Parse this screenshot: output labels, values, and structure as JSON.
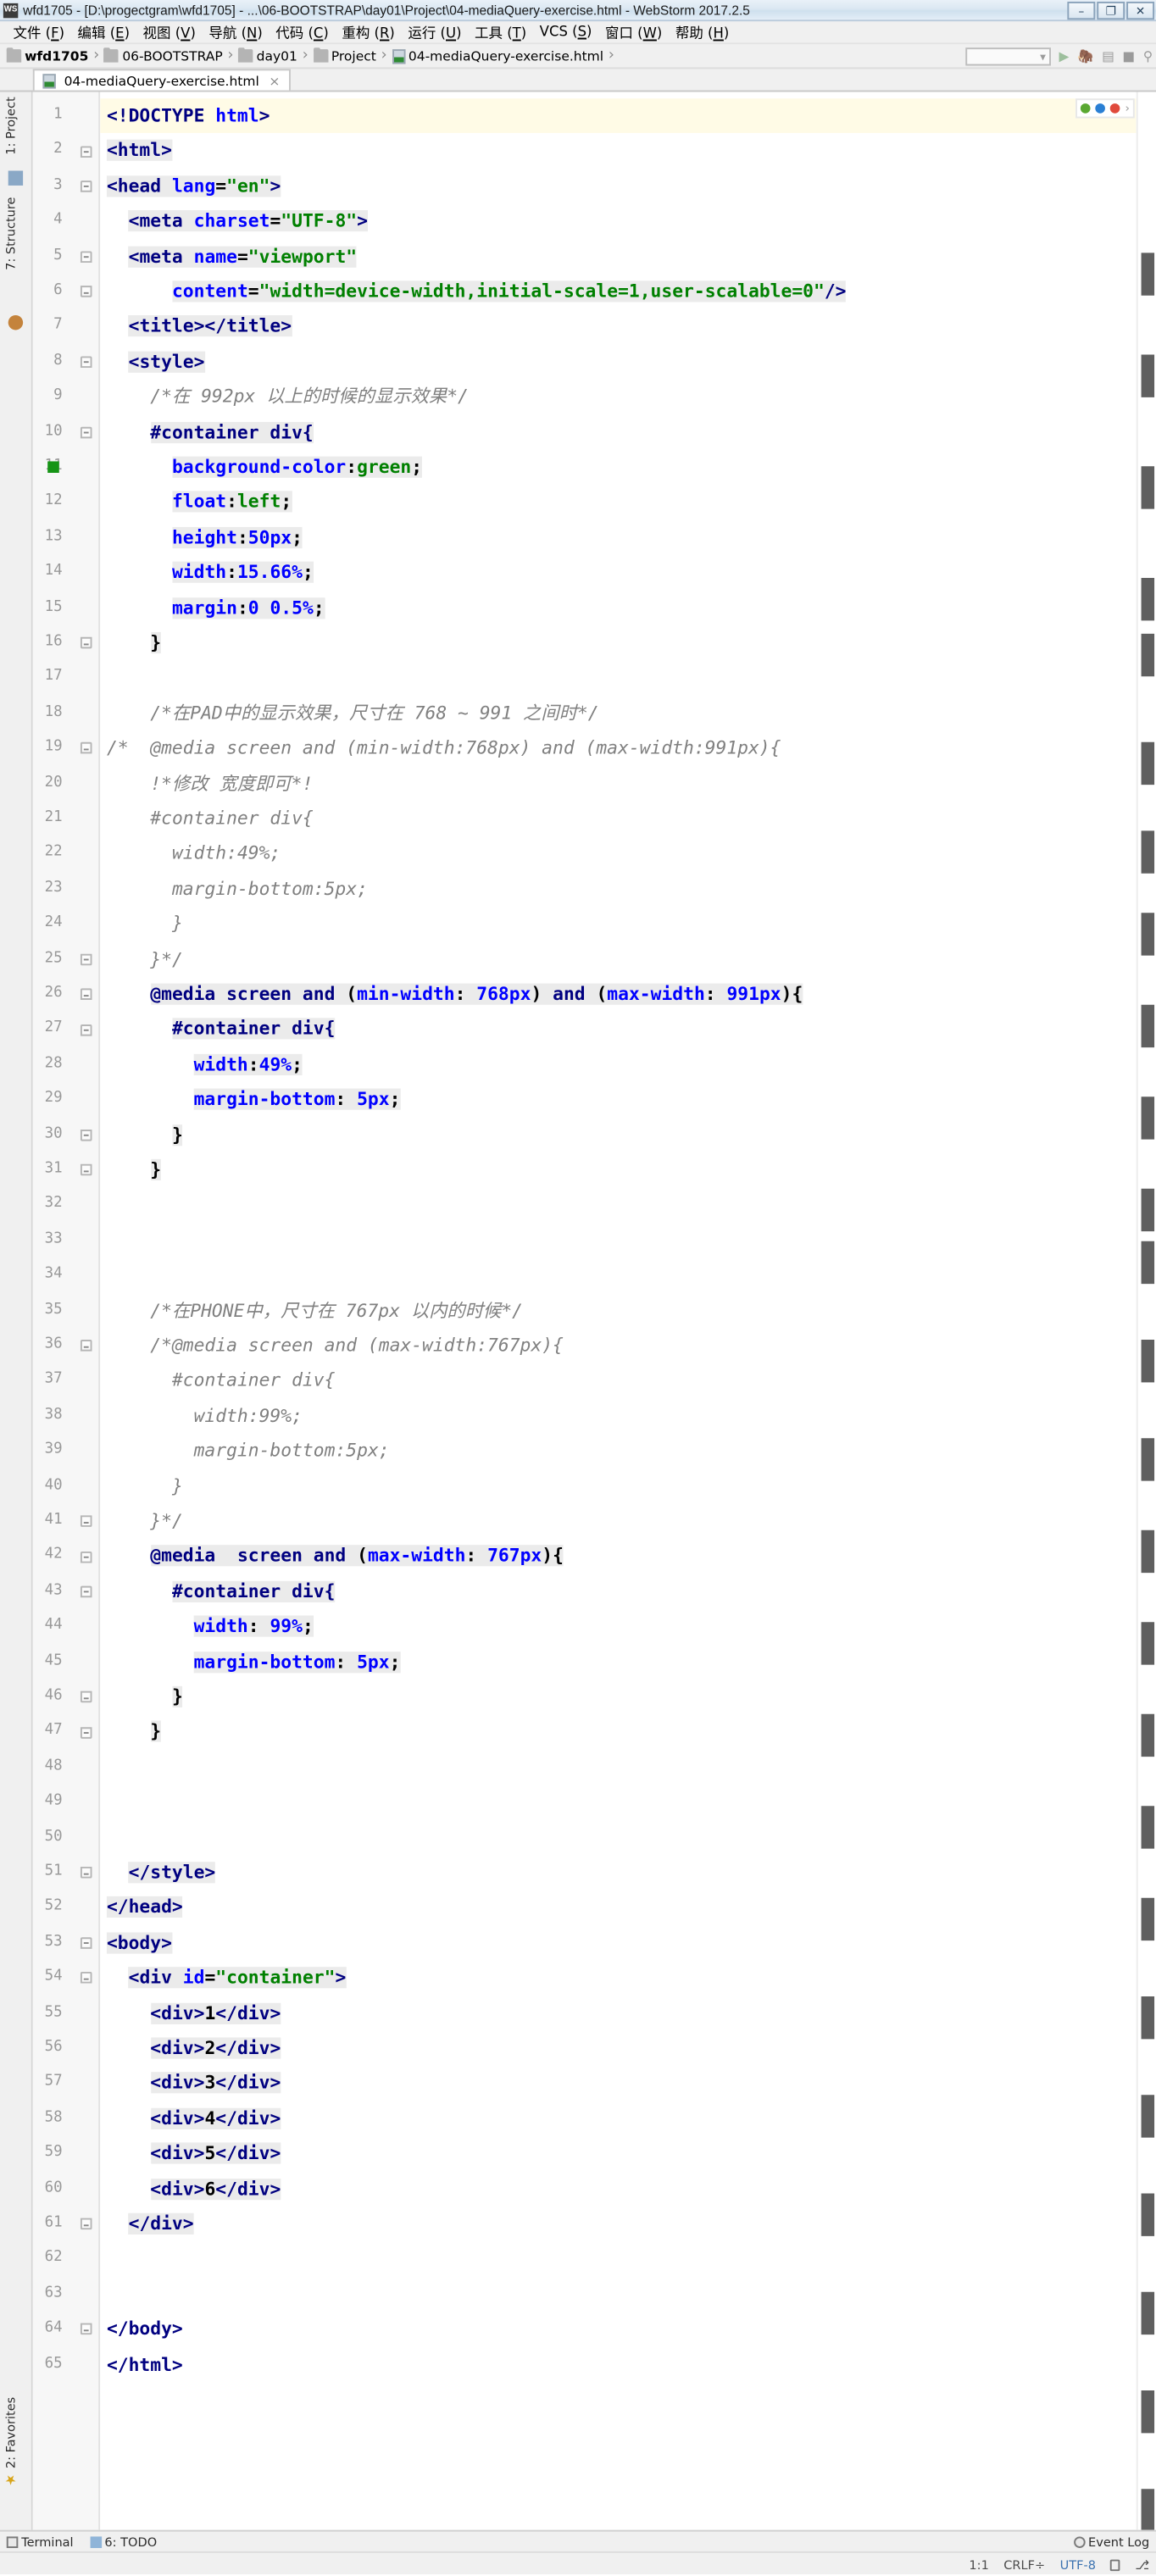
{
  "window": {
    "app_icon_text": "WS",
    "title": "wfd1705 - [D:\\progectgram\\wfd1705] - ...\\06-BOOTSTRAP\\day01\\Project\\04-mediaQuery-exercise.html - WebStorm 2017.2.5",
    "minimize": "–",
    "restore": "❐",
    "close": "✕"
  },
  "menubar": [
    {
      "label": "文件",
      "mnemonic": "F"
    },
    {
      "label": "编辑",
      "mnemonic": "E"
    },
    {
      "label": "视图",
      "mnemonic": "V"
    },
    {
      "label": "导航",
      "mnemonic": "N"
    },
    {
      "label": "代码",
      "mnemonic": "C"
    },
    {
      "label": "重构",
      "mnemonic": "R"
    },
    {
      "label": "运行",
      "mnemonic": "U"
    },
    {
      "label": "工具",
      "mnemonic": "T"
    },
    {
      "label": "VCS",
      "mnemonic": "S"
    },
    {
      "label": "窗口",
      "mnemonic": "W"
    },
    {
      "label": "帮助",
      "mnemonic": "H"
    }
  ],
  "breadcrumb": [
    {
      "label": "wfd1705",
      "icon": "folder-icon",
      "bold": true
    },
    {
      "label": "06-BOOTSTRAP",
      "icon": "folder-icon",
      "bold": false
    },
    {
      "label": "day01",
      "icon": "folder-icon",
      "bold": false
    },
    {
      "label": "Project",
      "icon": "folder-icon",
      "bold": false
    },
    {
      "label": "04-mediaQuery-exercise.html",
      "icon": "html-file-icon",
      "bold": false
    }
  ],
  "toolbar": {
    "run_config_placeholder": "",
    "icons": [
      "chevron-down-icon",
      "run-icon",
      "debug-icon",
      "coverage-icon",
      "stop-icon",
      "search-icon"
    ]
  },
  "tabs": [
    {
      "label": "04-mediaQuery-exercise.html",
      "icon": "html-file-icon",
      "close": "×",
      "active": true
    }
  ],
  "left_tool_window": [
    {
      "label": "1: Project",
      "mnemonic": "1"
    },
    {
      "label": "7: Structure",
      "mnemonic": "7"
    }
  ],
  "favorites": {
    "label": "2: Favorites",
    "star": "★"
  },
  "editor": {
    "first_line": 1,
    "total_lines": 65,
    "lines": [
      {
        "n": 1,
        "indent": 0,
        "tokens": [
          {
            "t": "tag",
            "v": "<!DOCTYPE "
          },
          {
            "t": "attr",
            "v": "html"
          },
          {
            "t": "tag",
            "v": ">"
          }
        ]
      },
      {
        "n": 2,
        "indent": 0,
        "tokens": [
          {
            "t": "tag",
            "v": "<html>"
          }
        ]
      },
      {
        "n": 3,
        "indent": 0,
        "tokens": [
          {
            "t": "tag",
            "v": "<head "
          },
          {
            "t": "attr",
            "v": "lang"
          },
          {
            "t": "plain",
            "v": "="
          },
          {
            "t": "val",
            "v": "\"en\""
          },
          {
            "t": "tag",
            "v": ">"
          }
        ]
      },
      {
        "n": 4,
        "indent": 1,
        "tokens": [
          {
            "t": "tag",
            "v": "<meta "
          },
          {
            "t": "attr",
            "v": "charset"
          },
          {
            "t": "plain",
            "v": "="
          },
          {
            "t": "val",
            "v": "\"UTF-8\""
          },
          {
            "t": "tag",
            "v": ">"
          }
        ]
      },
      {
        "n": 5,
        "indent": 1,
        "tokens": [
          {
            "t": "tag",
            "v": "<meta "
          },
          {
            "t": "attr",
            "v": "name"
          },
          {
            "t": "plain",
            "v": "="
          },
          {
            "t": "val",
            "v": "\"viewport\""
          }
        ]
      },
      {
        "n": 6,
        "indent": 3,
        "tokens": [
          {
            "t": "attr",
            "v": "content"
          },
          {
            "t": "plain",
            "v": "="
          },
          {
            "t": "val",
            "v": "\"width=device-width,initial-scale=1,user-scalable=0\""
          },
          {
            "t": "tag",
            "v": "/>"
          }
        ]
      },
      {
        "n": 7,
        "indent": 1,
        "tokens": [
          {
            "t": "tag",
            "v": "<title></title>"
          }
        ]
      },
      {
        "n": 8,
        "indent": 1,
        "tokens": [
          {
            "t": "tag",
            "v": "<style>"
          }
        ]
      },
      {
        "n": 9,
        "indent": 2,
        "tokens": [
          {
            "t": "cmt",
            "v": "/*在 992px 以上的时候的显示效果*/"
          }
        ]
      },
      {
        "n": 10,
        "indent": 2,
        "tokens": [
          {
            "t": "sel",
            "v": "#container div{"
          }
        ]
      },
      {
        "n": 11,
        "indent": 3,
        "tokens": [
          {
            "t": "prop",
            "v": "background-color"
          },
          {
            "t": "punc",
            "v": ":"
          },
          {
            "t": "pval",
            "v": "green"
          },
          {
            "t": "punc",
            "v": ";"
          }
        ]
      },
      {
        "n": 12,
        "indent": 3,
        "tokens": [
          {
            "t": "prop",
            "v": "float"
          },
          {
            "t": "punc",
            "v": ":"
          },
          {
            "t": "pval",
            "v": "left"
          },
          {
            "t": "punc",
            "v": ";"
          }
        ]
      },
      {
        "n": 13,
        "indent": 3,
        "tokens": [
          {
            "t": "prop",
            "v": "height"
          },
          {
            "t": "punc",
            "v": ":"
          },
          {
            "t": "num",
            "v": "50px"
          },
          {
            "t": "punc",
            "v": ";"
          }
        ]
      },
      {
        "n": 14,
        "indent": 3,
        "tokens": [
          {
            "t": "prop",
            "v": "width"
          },
          {
            "t": "punc",
            "v": ":"
          },
          {
            "t": "num",
            "v": "15.66%"
          },
          {
            "t": "punc",
            "v": ";"
          }
        ]
      },
      {
        "n": 15,
        "indent": 3,
        "tokens": [
          {
            "t": "prop",
            "v": "margin"
          },
          {
            "t": "punc",
            "v": ":"
          },
          {
            "t": "num",
            "v": "0 0.5%"
          },
          {
            "t": "punc",
            "v": ";"
          }
        ]
      },
      {
        "n": 16,
        "indent": 2,
        "tokens": [
          {
            "t": "punc",
            "v": "}"
          }
        ]
      },
      {
        "n": 17,
        "indent": 0,
        "tokens": []
      },
      {
        "n": 18,
        "indent": 2,
        "tokens": [
          {
            "t": "cmt",
            "v": "/*在PAD中的显示效果，尺寸在 768 ~ 991 之间时*/"
          }
        ]
      },
      {
        "n": 19,
        "indent": 0,
        "tokens": [
          {
            "t": "cmt",
            "v": "/*  @media screen and (min-width:768px) and (max-width:991px){"
          }
        ]
      },
      {
        "n": 20,
        "indent": 2,
        "tokens": [
          {
            "t": "cmt",
            "v": "!*修改 宽度即可*!"
          }
        ]
      },
      {
        "n": 21,
        "indent": 2,
        "tokens": [
          {
            "t": "cmt",
            "v": "#container div{"
          }
        ]
      },
      {
        "n": 22,
        "indent": 3,
        "tokens": [
          {
            "t": "cmt",
            "v": "width:49%;"
          }
        ]
      },
      {
        "n": 23,
        "indent": 3,
        "tokens": [
          {
            "t": "cmt",
            "v": "margin-bottom:5px;"
          }
        ]
      },
      {
        "n": 24,
        "indent": 3,
        "tokens": [
          {
            "t": "cmt",
            "v": "}"
          }
        ]
      },
      {
        "n": 25,
        "indent": 2,
        "tokens": [
          {
            "t": "cmt",
            "v": "}*/"
          }
        ]
      },
      {
        "n": 26,
        "indent": 2,
        "tokens": [
          {
            "t": "kw",
            "v": "@media "
          },
          {
            "t": "sel",
            "v": "screen "
          },
          {
            "t": "kw",
            "v": "and "
          },
          {
            "t": "punc",
            "v": "("
          },
          {
            "t": "prop",
            "v": "min-width"
          },
          {
            "t": "punc",
            "v": ": "
          },
          {
            "t": "num",
            "v": "768px"
          },
          {
            "t": "punc",
            "v": ") "
          },
          {
            "t": "kw",
            "v": "and "
          },
          {
            "t": "punc",
            "v": "("
          },
          {
            "t": "prop",
            "v": "max-width"
          },
          {
            "t": "punc",
            "v": ": "
          },
          {
            "t": "num",
            "v": "991px"
          },
          {
            "t": "punc",
            "v": "){"
          }
        ]
      },
      {
        "n": 27,
        "indent": 3,
        "tokens": [
          {
            "t": "sel",
            "v": "#container div{"
          }
        ]
      },
      {
        "n": 28,
        "indent": 4,
        "tokens": [
          {
            "t": "prop",
            "v": "width"
          },
          {
            "t": "punc",
            "v": ":"
          },
          {
            "t": "num",
            "v": "49%"
          },
          {
            "t": "punc",
            "v": ";"
          }
        ]
      },
      {
        "n": 29,
        "indent": 4,
        "tokens": [
          {
            "t": "prop",
            "v": "margin-bottom"
          },
          {
            "t": "punc",
            "v": ": "
          },
          {
            "t": "num",
            "v": "5px"
          },
          {
            "t": "punc",
            "v": ";"
          }
        ]
      },
      {
        "n": 30,
        "indent": 3,
        "tokens": [
          {
            "t": "punc",
            "v": "}"
          }
        ]
      },
      {
        "n": 31,
        "indent": 2,
        "tokens": [
          {
            "t": "punc",
            "v": "}"
          }
        ]
      },
      {
        "n": 32,
        "indent": 0,
        "tokens": []
      },
      {
        "n": 33,
        "indent": 0,
        "tokens": []
      },
      {
        "n": 34,
        "indent": 0,
        "tokens": []
      },
      {
        "n": 35,
        "indent": 2,
        "tokens": [
          {
            "t": "cmt",
            "v": "/*在PHONE中，尺寸在 767px 以内的时候*/"
          }
        ]
      },
      {
        "n": 36,
        "indent": 2,
        "tokens": [
          {
            "t": "cmt",
            "v": "/*@media screen and (max-width:767px){"
          }
        ]
      },
      {
        "n": 37,
        "indent": 3,
        "tokens": [
          {
            "t": "cmt",
            "v": "#container div{"
          }
        ]
      },
      {
        "n": 38,
        "indent": 4,
        "tokens": [
          {
            "t": "cmt",
            "v": "width:99%;"
          }
        ]
      },
      {
        "n": 39,
        "indent": 4,
        "tokens": [
          {
            "t": "cmt",
            "v": "margin-bottom:5px;"
          }
        ]
      },
      {
        "n": 40,
        "indent": 3,
        "tokens": [
          {
            "t": "cmt",
            "v": "}"
          }
        ]
      },
      {
        "n": 41,
        "indent": 2,
        "tokens": [
          {
            "t": "cmt",
            "v": "}*/"
          }
        ]
      },
      {
        "n": 42,
        "indent": 2,
        "tokens": [
          {
            "t": "kw",
            "v": "@media  "
          },
          {
            "t": "sel",
            "v": "screen "
          },
          {
            "t": "kw",
            "v": "and "
          },
          {
            "t": "punc",
            "v": "("
          },
          {
            "t": "prop",
            "v": "max-width"
          },
          {
            "t": "punc",
            "v": ": "
          },
          {
            "t": "num",
            "v": "767px"
          },
          {
            "t": "punc",
            "v": "){"
          }
        ]
      },
      {
        "n": 43,
        "indent": 3,
        "tokens": [
          {
            "t": "sel",
            "v": "#container div{"
          }
        ]
      },
      {
        "n": 44,
        "indent": 4,
        "tokens": [
          {
            "t": "prop",
            "v": "width"
          },
          {
            "t": "punc",
            "v": ": "
          },
          {
            "t": "num",
            "v": "99%"
          },
          {
            "t": "punc",
            "v": ";"
          }
        ]
      },
      {
        "n": 45,
        "indent": 4,
        "tokens": [
          {
            "t": "prop",
            "v": "margin-bottom"
          },
          {
            "t": "punc",
            "v": ": "
          },
          {
            "t": "num",
            "v": "5px"
          },
          {
            "t": "punc",
            "v": ";"
          }
        ]
      },
      {
        "n": 46,
        "indent": 3,
        "tokens": [
          {
            "t": "punc",
            "v": "}"
          }
        ]
      },
      {
        "n": 47,
        "indent": 2,
        "tokens": [
          {
            "t": "punc",
            "v": "}"
          }
        ]
      },
      {
        "n": 48,
        "indent": 0,
        "tokens": []
      },
      {
        "n": 49,
        "indent": 0,
        "tokens": []
      },
      {
        "n": 50,
        "indent": 0,
        "tokens": []
      },
      {
        "n": 51,
        "indent": 1,
        "tokens": [
          {
            "t": "tag",
            "v": "</style>"
          }
        ]
      },
      {
        "n": 52,
        "indent": 0,
        "tokens": [
          {
            "t": "tag",
            "v": "</head>"
          }
        ]
      },
      {
        "n": 53,
        "indent": 0,
        "tokens": [
          {
            "t": "tag",
            "v": "<body>"
          }
        ]
      },
      {
        "n": 54,
        "indent": 1,
        "tokens": [
          {
            "t": "tag",
            "v": "<div "
          },
          {
            "t": "attr",
            "v": "id"
          },
          {
            "t": "plain",
            "v": "="
          },
          {
            "t": "val",
            "v": "\"container\""
          },
          {
            "t": "tag",
            "v": ">"
          }
        ]
      },
      {
        "n": 55,
        "indent": 2,
        "tokens": [
          {
            "t": "tag",
            "v": "<div>"
          },
          {
            "t": "plain",
            "v": "1"
          },
          {
            "t": "tag",
            "v": "</div>"
          }
        ]
      },
      {
        "n": 56,
        "indent": 2,
        "tokens": [
          {
            "t": "tag",
            "v": "<div>"
          },
          {
            "t": "plain",
            "v": "2"
          },
          {
            "t": "tag",
            "v": "</div>"
          }
        ]
      },
      {
        "n": 57,
        "indent": 2,
        "tokens": [
          {
            "t": "tag",
            "v": "<div>"
          },
          {
            "t": "plain",
            "v": "3"
          },
          {
            "t": "tag",
            "v": "</div>"
          }
        ]
      },
      {
        "n": 58,
        "indent": 2,
        "tokens": [
          {
            "t": "tag",
            "v": "<div>"
          },
          {
            "t": "plain",
            "v": "4"
          },
          {
            "t": "tag",
            "v": "</div>"
          }
        ]
      },
      {
        "n": 59,
        "indent": 2,
        "tokens": [
          {
            "t": "tag",
            "v": "<div>"
          },
          {
            "t": "plain",
            "v": "5"
          },
          {
            "t": "tag",
            "v": "</div>"
          }
        ]
      },
      {
        "n": 60,
        "indent": 2,
        "tokens": [
          {
            "t": "tag",
            "v": "<div>"
          },
          {
            "t": "plain",
            "v": "6"
          },
          {
            "t": "tag",
            "v": "</div>"
          }
        ]
      },
      {
        "n": 61,
        "indent": 1,
        "tokens": [
          {
            "t": "tag",
            "v": "</div>"
          }
        ]
      },
      {
        "n": 62,
        "indent": 0,
        "tokens": []
      },
      {
        "n": 63,
        "indent": 0,
        "tokens": []
      },
      {
        "n": 64,
        "indent": 0,
        "tokens": [
          {
            "t": "tag",
            "v": "</body>"
          }
        ]
      },
      {
        "n": 65,
        "indent": 0,
        "tokens": [
          {
            "t": "tag",
            "v": "</html>"
          }
        ]
      }
    ],
    "folds": [
      {
        "line": 2,
        "type": "start"
      },
      {
        "line": 3,
        "type": "start"
      },
      {
        "line": 5,
        "type": "start"
      },
      {
        "line": 6,
        "type": "end"
      },
      {
        "line": 8,
        "type": "start"
      },
      {
        "line": 10,
        "type": "start"
      },
      {
        "line": 16,
        "type": "end"
      },
      {
        "line": 19,
        "type": "start"
      },
      {
        "line": 25,
        "type": "end"
      },
      {
        "line": 26,
        "type": "start"
      },
      {
        "line": 27,
        "type": "start"
      },
      {
        "line": 30,
        "type": "end"
      },
      {
        "line": 31,
        "type": "end"
      },
      {
        "line": 36,
        "type": "start"
      },
      {
        "line": 41,
        "type": "end"
      },
      {
        "line": 42,
        "type": "start"
      },
      {
        "line": 43,
        "type": "start"
      },
      {
        "line": 46,
        "type": "end"
      },
      {
        "line": 47,
        "type": "end"
      },
      {
        "line": 51,
        "type": "end"
      },
      {
        "line": 53,
        "type": "start"
      },
      {
        "line": 54,
        "type": "start"
      },
      {
        "line": 61,
        "type": "end"
      },
      {
        "line": 64,
        "type": "end"
      }
    ],
    "gutter_color_mark_line": 11,
    "gutter_color_mark_hex": "#169416",
    "highlighted_line": 1
  },
  "inspection_widget": {
    "ok_color": "#5aa832",
    "info_color": "#2a7fd4",
    "error_color": "#e04a3c",
    "chevron": "›"
  },
  "bottom_toolwindows": [
    {
      "label": "Terminal",
      "icon": "terminal-icon"
    },
    {
      "label": "6: TODO",
      "icon": "todo-icon"
    }
  ],
  "event_log": {
    "label": "Event Log",
    "icon": "event-log-icon"
  },
  "statusbar": {
    "caret": "1:1",
    "line_separator": "CRLF÷",
    "encoding": "UTF-8",
    "lock": "lock-icon",
    "branch": "⎇"
  }
}
